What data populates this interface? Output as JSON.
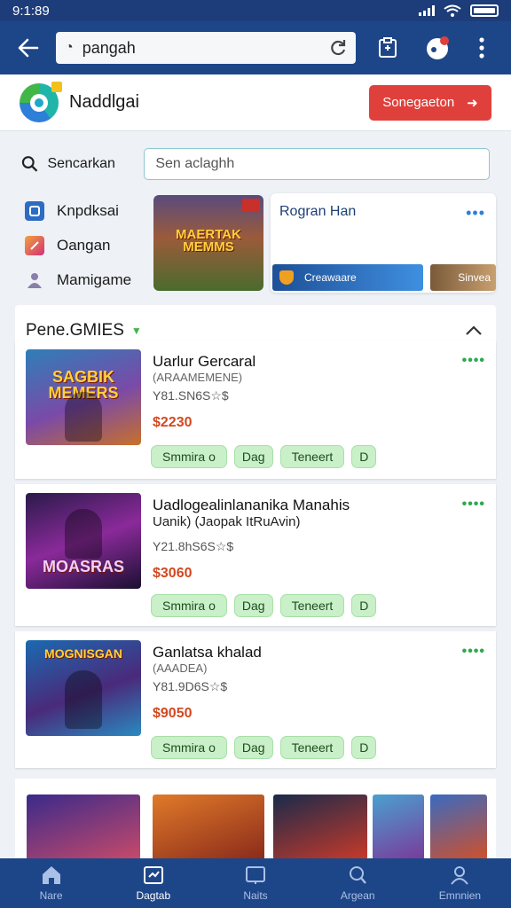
{
  "status": {
    "time": "9:1:89"
  },
  "browser": {
    "url": "pangah"
  },
  "site": {
    "name": "Naddlgai",
    "cta": "Sonegaeton"
  },
  "search": {
    "label": "Sencarkan",
    "placeholder": "Sen aclaghh"
  },
  "sidebar": {
    "items": [
      {
        "label": "Knpdksai",
        "icon": "square-icon"
      },
      {
        "label": "Oangan",
        "icon": "gamepad-icon"
      },
      {
        "label": "Mamigame",
        "icon": "person-icon"
      }
    ]
  },
  "featured": {
    "art_title": "MAERTAK MEMMS",
    "card_title": "Rogran Han",
    "promo": "Creawaare",
    "thumb_label": "Sinvea"
  },
  "games_section": {
    "title": "Pene.GMIES"
  },
  "games": [
    {
      "title": "Uarlur Gercaral",
      "subtitle": "(ARAAMEMENE)",
      "meta": "Y81.SN6S☆$",
      "price": "$2230",
      "art": "SAGBIK MEMERS",
      "chips": [
        "Smmira o",
        "Dag",
        "Teneert",
        "D"
      ]
    },
    {
      "title": "Uadlogealinlananika Manahis",
      "subtitle": "Uanik) (Jaopak ItRuAvin)",
      "meta": "Y21.8hS6S☆$",
      "price": "$3060",
      "art": "MOASRAS",
      "chips": [
        "Smmira o",
        "Dag",
        "Teneert",
        "D"
      ]
    },
    {
      "title": "Ganlatsa khalad",
      "subtitle": "(AAADEA)",
      "meta": "Y81.9D6S☆$",
      "price": "$9050",
      "art": "MOGNISGAN",
      "chips": [
        "Smmira o",
        "Dag",
        "Teneert",
        "D"
      ]
    }
  ],
  "bottom_nav": [
    {
      "label": "Nare",
      "icon": "home-icon"
    },
    {
      "label": "Dagtab",
      "icon": "tab-icon"
    },
    {
      "label": "Naits",
      "icon": "notification-icon"
    },
    {
      "label": "Argean",
      "icon": "search-icon"
    },
    {
      "label": "Emnnien",
      "icon": "profile-icon"
    }
  ],
  "colors": {
    "primary": "#1d4688",
    "accent": "#e0403c",
    "chip": "#c9f0c9",
    "price": "#d2481f"
  }
}
